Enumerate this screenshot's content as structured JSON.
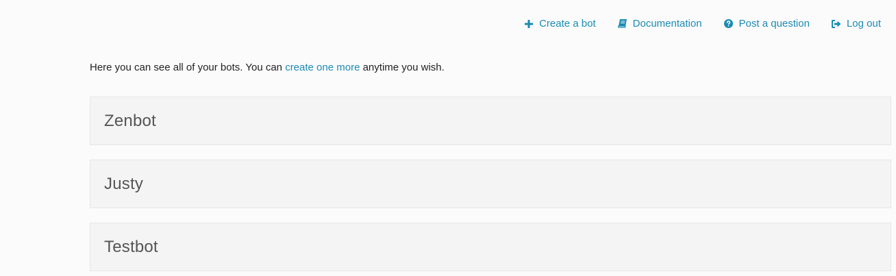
{
  "nav": {
    "items": [
      {
        "label": "Create a bot",
        "icon": "plus-icon"
      },
      {
        "label": "Documentation",
        "icon": "book-icon"
      },
      {
        "label": "Post a question",
        "icon": "question-circle-icon"
      },
      {
        "label": "Log out",
        "icon": "sign-out-icon"
      }
    ]
  },
  "intro": {
    "prefix": "Here you can see all of your bots. You can ",
    "link": "create one more",
    "suffix": " anytime you wish."
  },
  "bots": [
    {
      "name": "Zenbot"
    },
    {
      "name": "Justy"
    },
    {
      "name": "Testbot"
    }
  ],
  "colors": {
    "accent": "#1a8bb3",
    "background": "#fbfbfb",
    "card": "#f4f4f4"
  }
}
